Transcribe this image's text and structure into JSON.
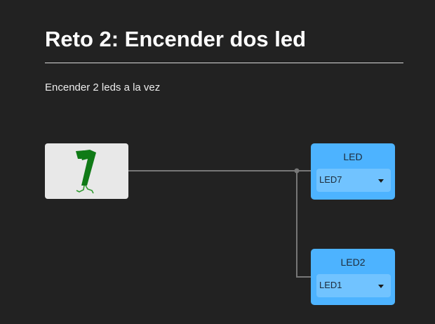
{
  "page": {
    "title": "Reto 2: Encender dos led",
    "description": "Encender 2 leds a la vez"
  },
  "colors": {
    "background": "#222222",
    "block_bit": "#e8e8e8",
    "block_led": "#4db3ff",
    "select": "#71c3ff",
    "wire": "#777777",
    "bit_glyph": "#0f7a16"
  },
  "blocks": {
    "bit": {
      "icon": "number-one-walking-icon"
    },
    "leds": [
      {
        "name": "LED",
        "selected": "LED7"
      },
      {
        "name": "LED2",
        "selected": "LED1"
      }
    ]
  }
}
